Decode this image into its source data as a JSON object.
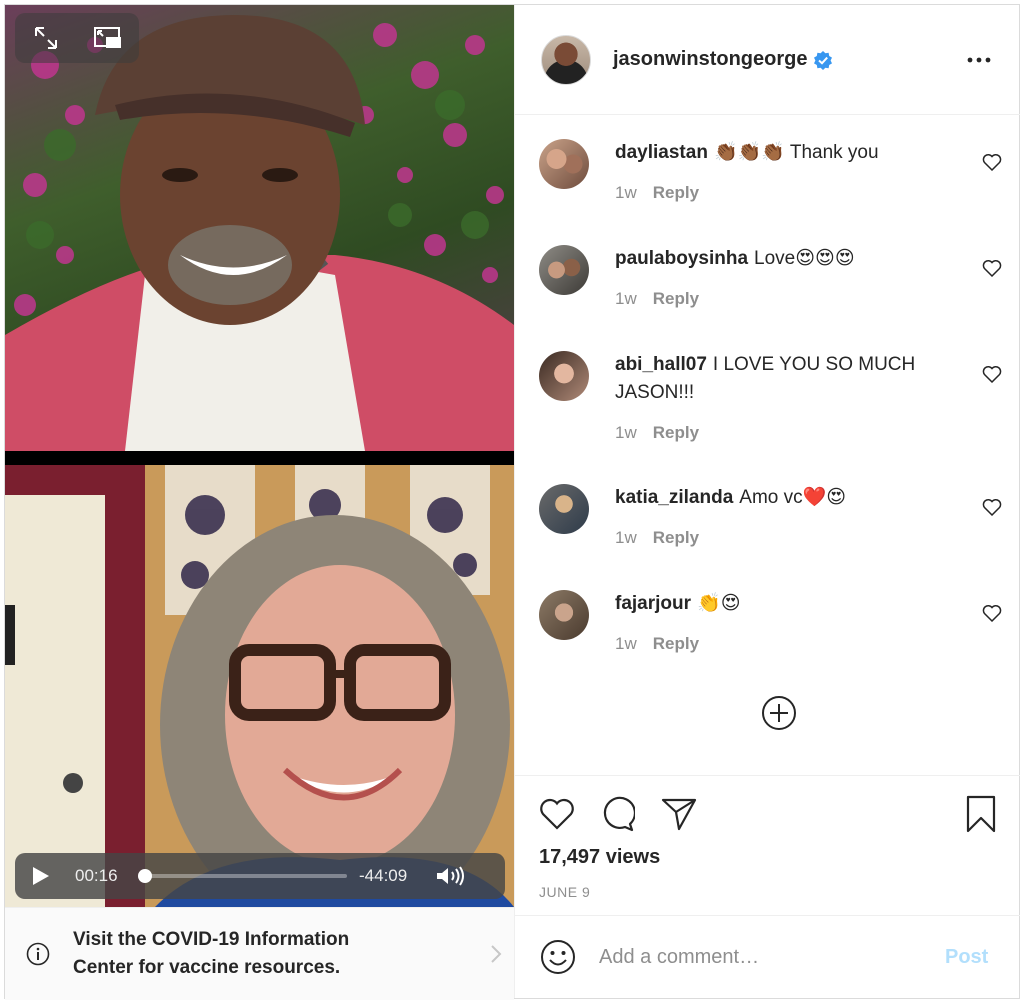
{
  "owner": {
    "username": "jasonwinstongeorge",
    "verified": true,
    "avatar_icon": "profile-photo"
  },
  "header": {
    "more_icon": "ellipsis-icon"
  },
  "video": {
    "top_controls": [
      "expand-icon",
      "picture-in-picture-icon"
    ],
    "current_time": "00:16",
    "remaining_time": "-44:09",
    "progress_fraction": 0.03,
    "play_icon": "play-icon",
    "volume_icon": "volume-icon"
  },
  "covid_banner": {
    "text": "Visit the COVID-19 Information Center for vaccine resources.",
    "icon": "info-icon"
  },
  "comments": [
    {
      "user": "dayliastan",
      "text": "👏🏾👏🏾👏🏾 Thank you",
      "age": "1w",
      "reply": "Reply"
    },
    {
      "user": "paulaboysinha",
      "text": "Love😍😍😍",
      "age": "1w",
      "reply": "Reply"
    },
    {
      "user": "abi_hall07",
      "text": "I LOVE YOU SO MUCH JASON!!!",
      "age": "1w",
      "reply": "Reply"
    },
    {
      "user": "katia_zilanda",
      "text": "Amo vc❤️😍",
      "age": "1w",
      "reply": "Reply"
    },
    {
      "user": "fajarjour",
      "text": "👏😍",
      "age": "1w",
      "reply": "Reply"
    }
  ],
  "stats": {
    "views": "17,497 views",
    "date": "JUNE 9"
  },
  "add_comment": {
    "placeholder": "Add a comment…",
    "post_label": "Post"
  },
  "colors": {
    "verified": "#3897f0",
    "post_disabled": "#b2dffc",
    "meta": "#8e8e8e"
  }
}
